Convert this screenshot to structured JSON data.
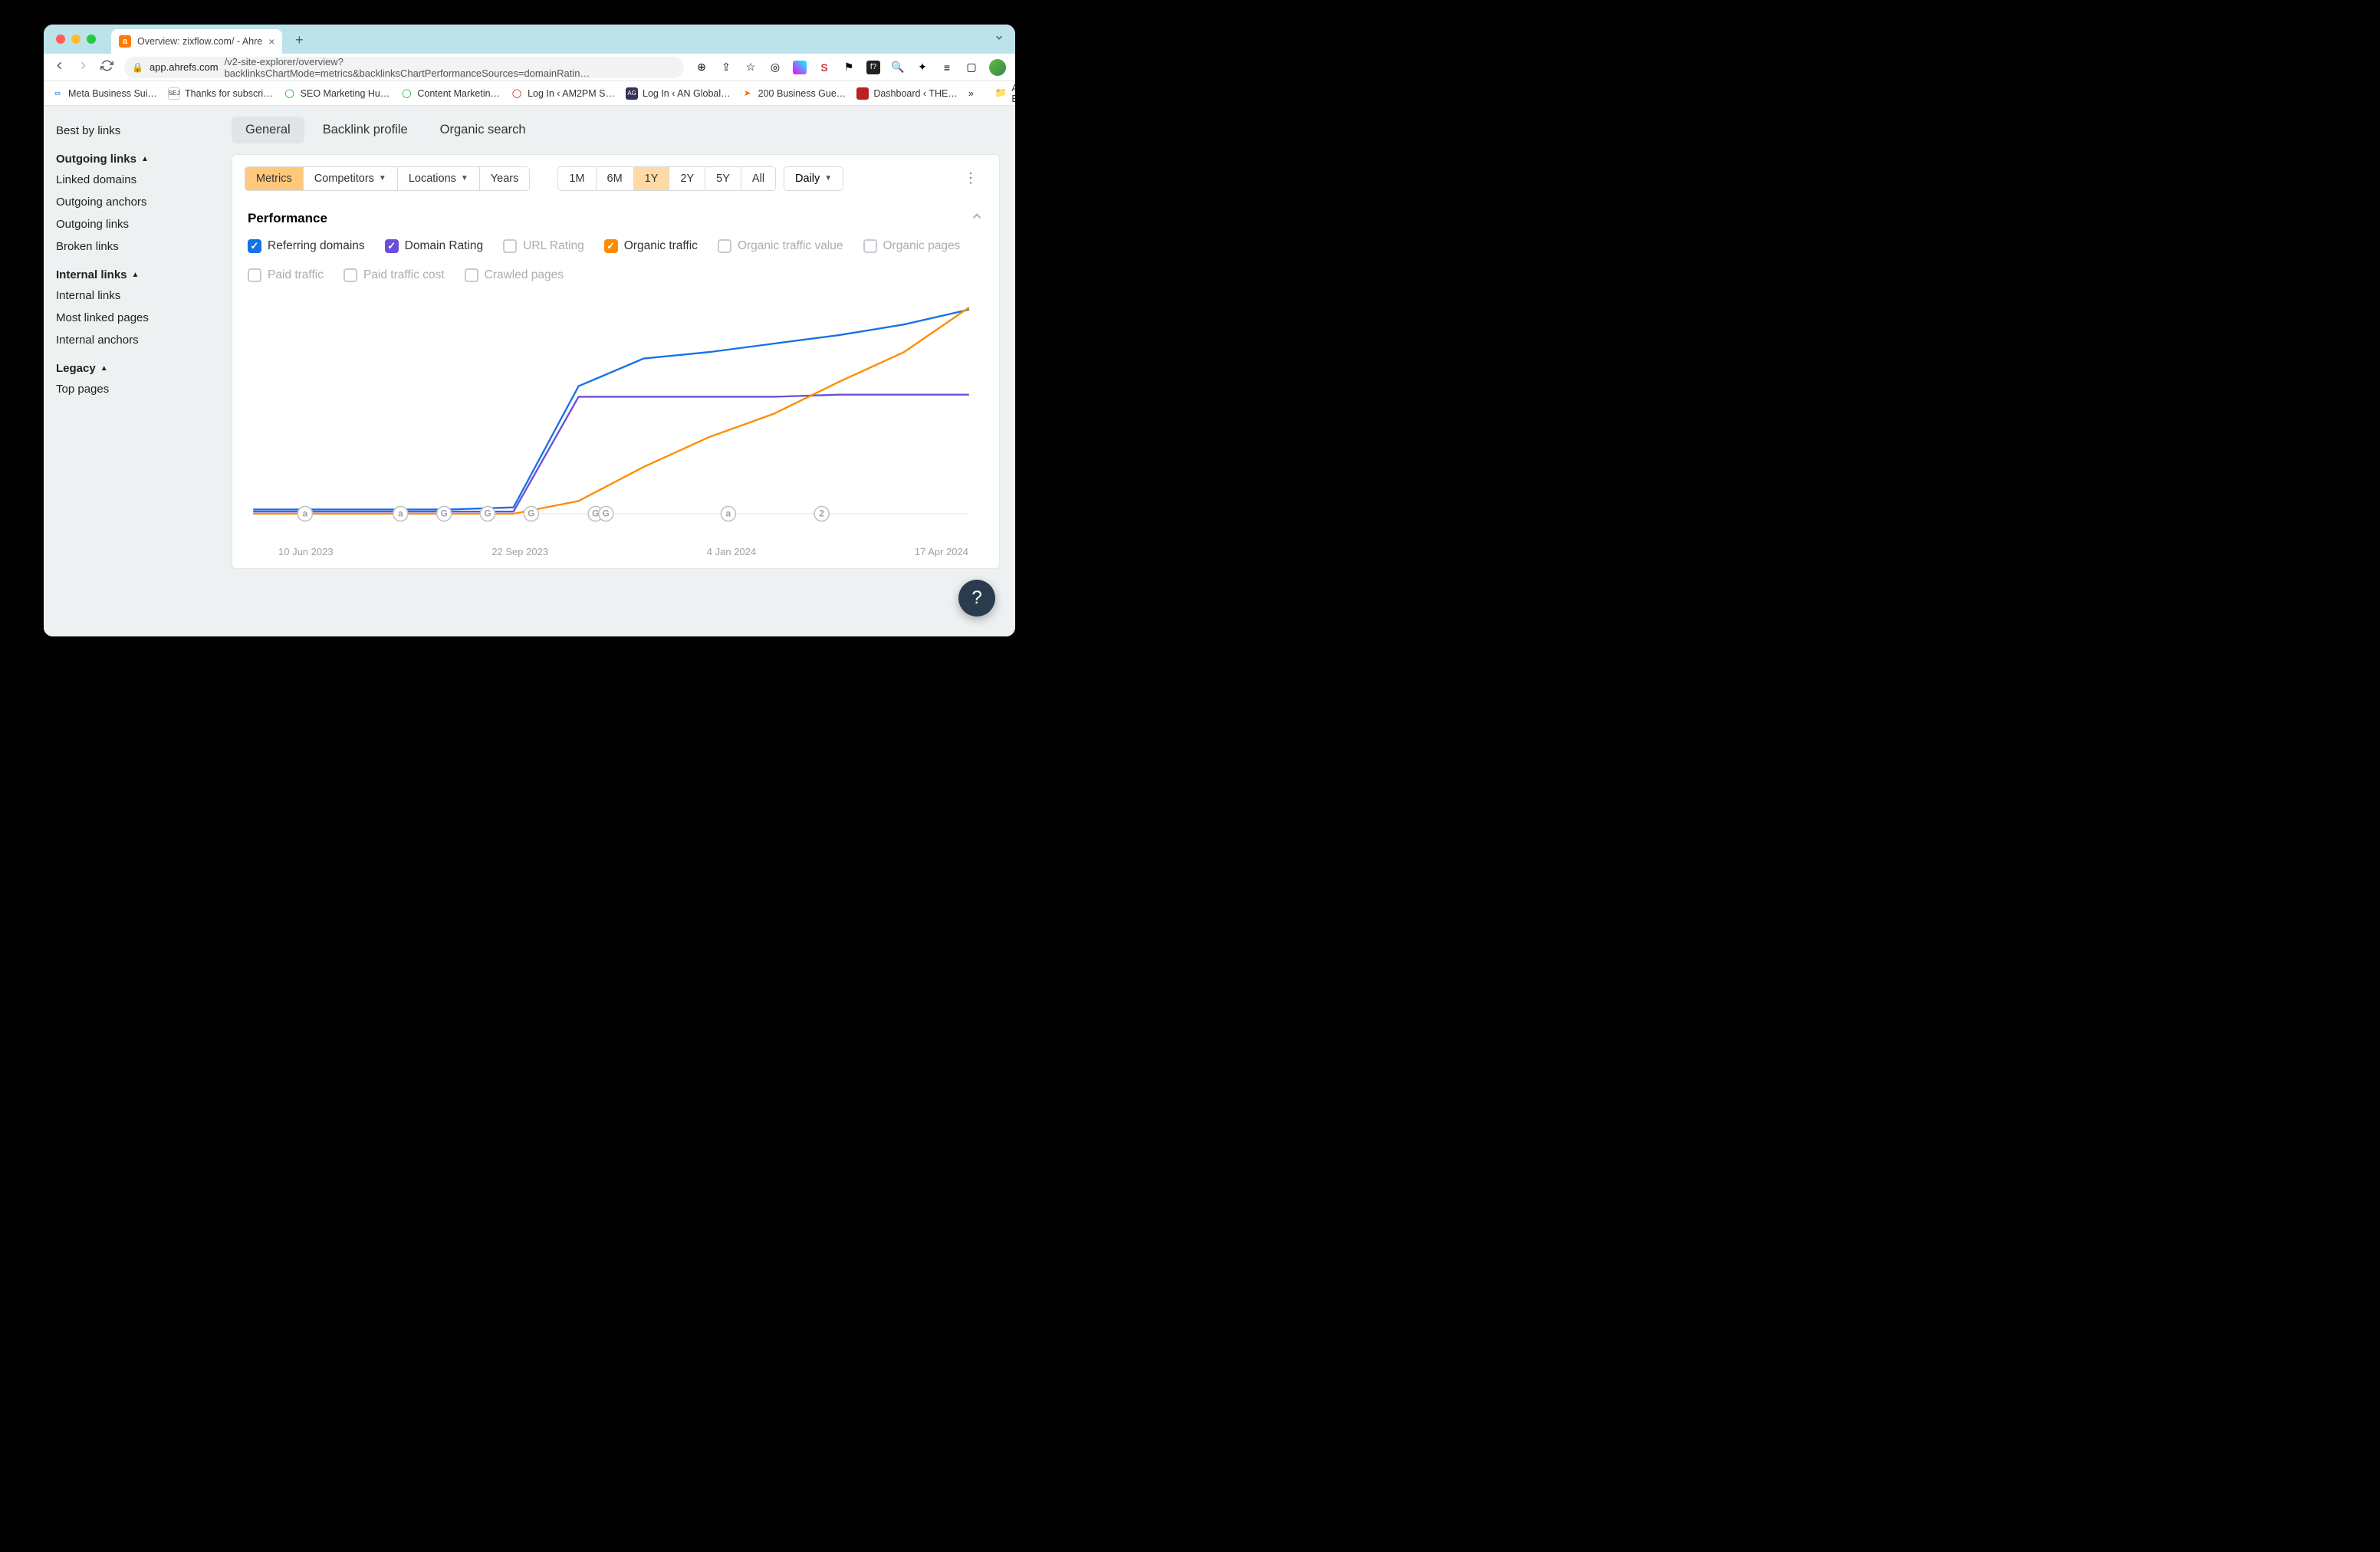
{
  "browser": {
    "tab_title": "Overview: zixflow.com/ - Ahre",
    "url_domain": "app.ahrefs.com",
    "url_path": "/v2-site-explorer/overview?backlinksChartMode=metrics&backlinksChartPerformanceSources=domainRatin…",
    "bookmarks": [
      "Meta Business Sui…",
      "Thanks for subscri…",
      "SEO Marketing Hu…",
      "Content Marketin…",
      "Log In ‹ AM2PM S…",
      "Log In ‹ AN Global…",
      "200 Business Gue…",
      "Dashboard ‹ THE…"
    ],
    "all_bookmarks": "All Bookmarks"
  },
  "sidebar": {
    "best_by_links": "Best by links",
    "group_outgoing": "Outgoing links",
    "outgoing": [
      "Linked domains",
      "Outgoing anchors",
      "Outgoing links",
      "Broken links"
    ],
    "group_internal": "Internal links",
    "internal": [
      "Internal links",
      "Most linked pages",
      "Internal anchors"
    ],
    "group_legacy": "Legacy",
    "legacy": [
      "Top pages"
    ]
  },
  "subtabs": {
    "general": "General",
    "backlink": "Backlink profile",
    "organic": "Organic search"
  },
  "controls": {
    "metrics": "Metrics",
    "competitors": "Competitors",
    "locations": "Locations",
    "years": "Years",
    "ranges": [
      "1M",
      "6M",
      "1Y",
      "2Y",
      "5Y",
      "All"
    ],
    "active_range": "1Y",
    "daily": "Daily"
  },
  "perf": {
    "title": "Performance",
    "checks": {
      "referring": "Referring domains",
      "dr": "Domain Rating",
      "url": "URL Rating",
      "otraffic": "Organic traffic",
      "ovalue": "Organic traffic value",
      "opages": "Organic pages",
      "ptraffic": "Paid traffic",
      "pcost": "Paid traffic cost",
      "crawled": "Crawled pages"
    }
  },
  "xlabels": [
    "10 Jun 2023",
    "22 Sep 2023",
    "4 Jan 2024",
    "17 Apr 2024"
  ],
  "help": "?",
  "chart_data": {
    "type": "line",
    "x_dates": [
      "2023-06-10",
      "2023-07-15",
      "2023-08-20",
      "2023-09-22",
      "2023-10-25",
      "2023-11-27",
      "2023-12-30",
      "2024-01-04",
      "2024-02-06",
      "2024-03-10",
      "2024-04-17",
      "2024-05-20"
    ],
    "series": [
      {
        "name": "Referring domains",
        "color": "#1473e6",
        "values": [
          2,
          2,
          2,
          2,
          3,
          60,
          73,
          76,
          80,
          84,
          89,
          96
        ]
      },
      {
        "name": "Domain Rating",
        "color": "#6b4fd8",
        "values": [
          1,
          1,
          1,
          1,
          1,
          55,
          55,
          55,
          55,
          56,
          56,
          56
        ]
      },
      {
        "name": "Organic traffic",
        "color": "#ff8c00",
        "values": [
          0,
          0,
          0,
          0,
          0,
          6,
          22,
          36,
          47,
          62,
          76,
          97
        ]
      }
    ],
    "ylim": [
      0,
      100
    ],
    "xlabel": "",
    "ylabel": "",
    "markers": [
      {
        "x": "2023-07-05",
        "label": "a"
      },
      {
        "x": "2023-08-20",
        "label": "a"
      },
      {
        "x": "2023-09-10",
        "label": "G"
      },
      {
        "x": "2023-10-01",
        "label": "G"
      },
      {
        "x": "2023-10-22",
        "label": "G"
      },
      {
        "x": "2023-11-22",
        "label": "G"
      },
      {
        "x": "2023-11-27",
        "label": "G"
      },
      {
        "x": "2024-01-25",
        "label": "a"
      },
      {
        "x": "2024-03-10",
        "label": "2"
      }
    ]
  }
}
